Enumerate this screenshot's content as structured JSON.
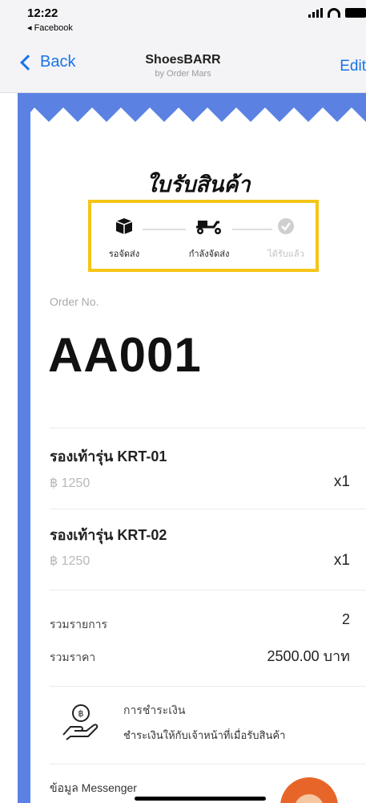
{
  "status_bar": {
    "time": "12:22",
    "back_app": "◂ Facebook"
  },
  "nav": {
    "back_label": "Back",
    "title": "ShoesBARR",
    "subtitle": "by Order Mars",
    "edit_label": "Edit"
  },
  "receipt": {
    "title": "ใบรับสินค้า",
    "steps": [
      {
        "label": "รอจัดส่ง",
        "icon": "box-icon",
        "state": "active"
      },
      {
        "label": "กำลังจัดส่ง",
        "icon": "scooter-icon",
        "state": "active"
      },
      {
        "label": "ได้รับแล้ว",
        "icon": "check-circle-icon",
        "state": "pending"
      }
    ],
    "highlight_color": "#f5c518",
    "order_label": "Order No.",
    "order_no": "AA001",
    "items": [
      {
        "name": "รองเท้ารุ่น KRT-01",
        "price": "฿ 1250",
        "qty": "x1"
      },
      {
        "name": "รองเท้ารุ่น KRT-02",
        "price": "฿ 1250",
        "qty": "x1"
      }
    ],
    "summary": {
      "count_label": "รวมรายการ",
      "count_value": "2",
      "total_label": "รวมราคา",
      "total_value": "2500.00 บาท"
    },
    "payment": {
      "title": "การชำระเงิน",
      "description": "ชำระเงินให้กับเจ้าหน้าที่เมื่อรับสินค้า",
      "icon": "hand-coin-icon"
    },
    "messenger_label": "ข้อมูล Messenger"
  },
  "colors": {
    "accent_blue": "#1a73e8",
    "background_blue": "#5b82e3"
  }
}
